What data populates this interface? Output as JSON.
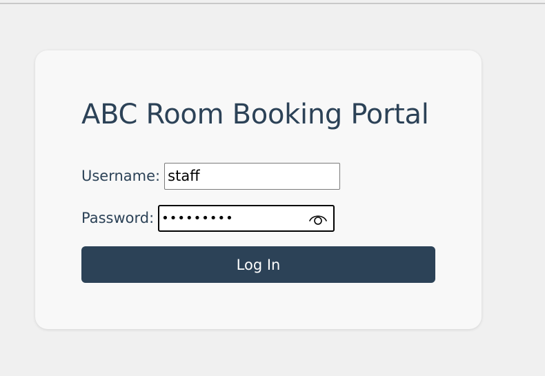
{
  "page": {
    "title": "ABC Room Booking Portal"
  },
  "form": {
    "username_label": "Username:",
    "username_value": "staff",
    "password_label": "Password:",
    "password_value": "•••••••••",
    "reveal_icon": "eye-icon",
    "login_label": "Log In"
  },
  "colors": {
    "background": "#f0f0f0",
    "card": "#f8f8f8",
    "accent": "#2c4257"
  }
}
